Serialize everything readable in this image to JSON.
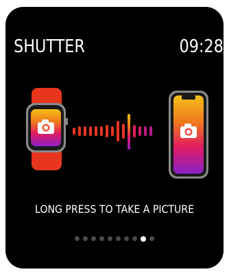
{
  "header": {
    "app_title": "SHUTTER",
    "clock": "09:28"
  },
  "instruction": "LONG PRESS TO TAKE A PICTURE",
  "pagination": {
    "total": 10,
    "active_index": 8
  },
  "colors": {
    "background": "#000000",
    "watch_band": "#e8361e",
    "gradient": [
      "#f5c018",
      "#f0771f",
      "#e11d5f",
      "#8b1fc7"
    ]
  },
  "icons": {
    "watch": "apple-watch-icon",
    "phone": "iphone-icon",
    "camera": "camera-icon",
    "signal": "signal-wave-icon"
  }
}
